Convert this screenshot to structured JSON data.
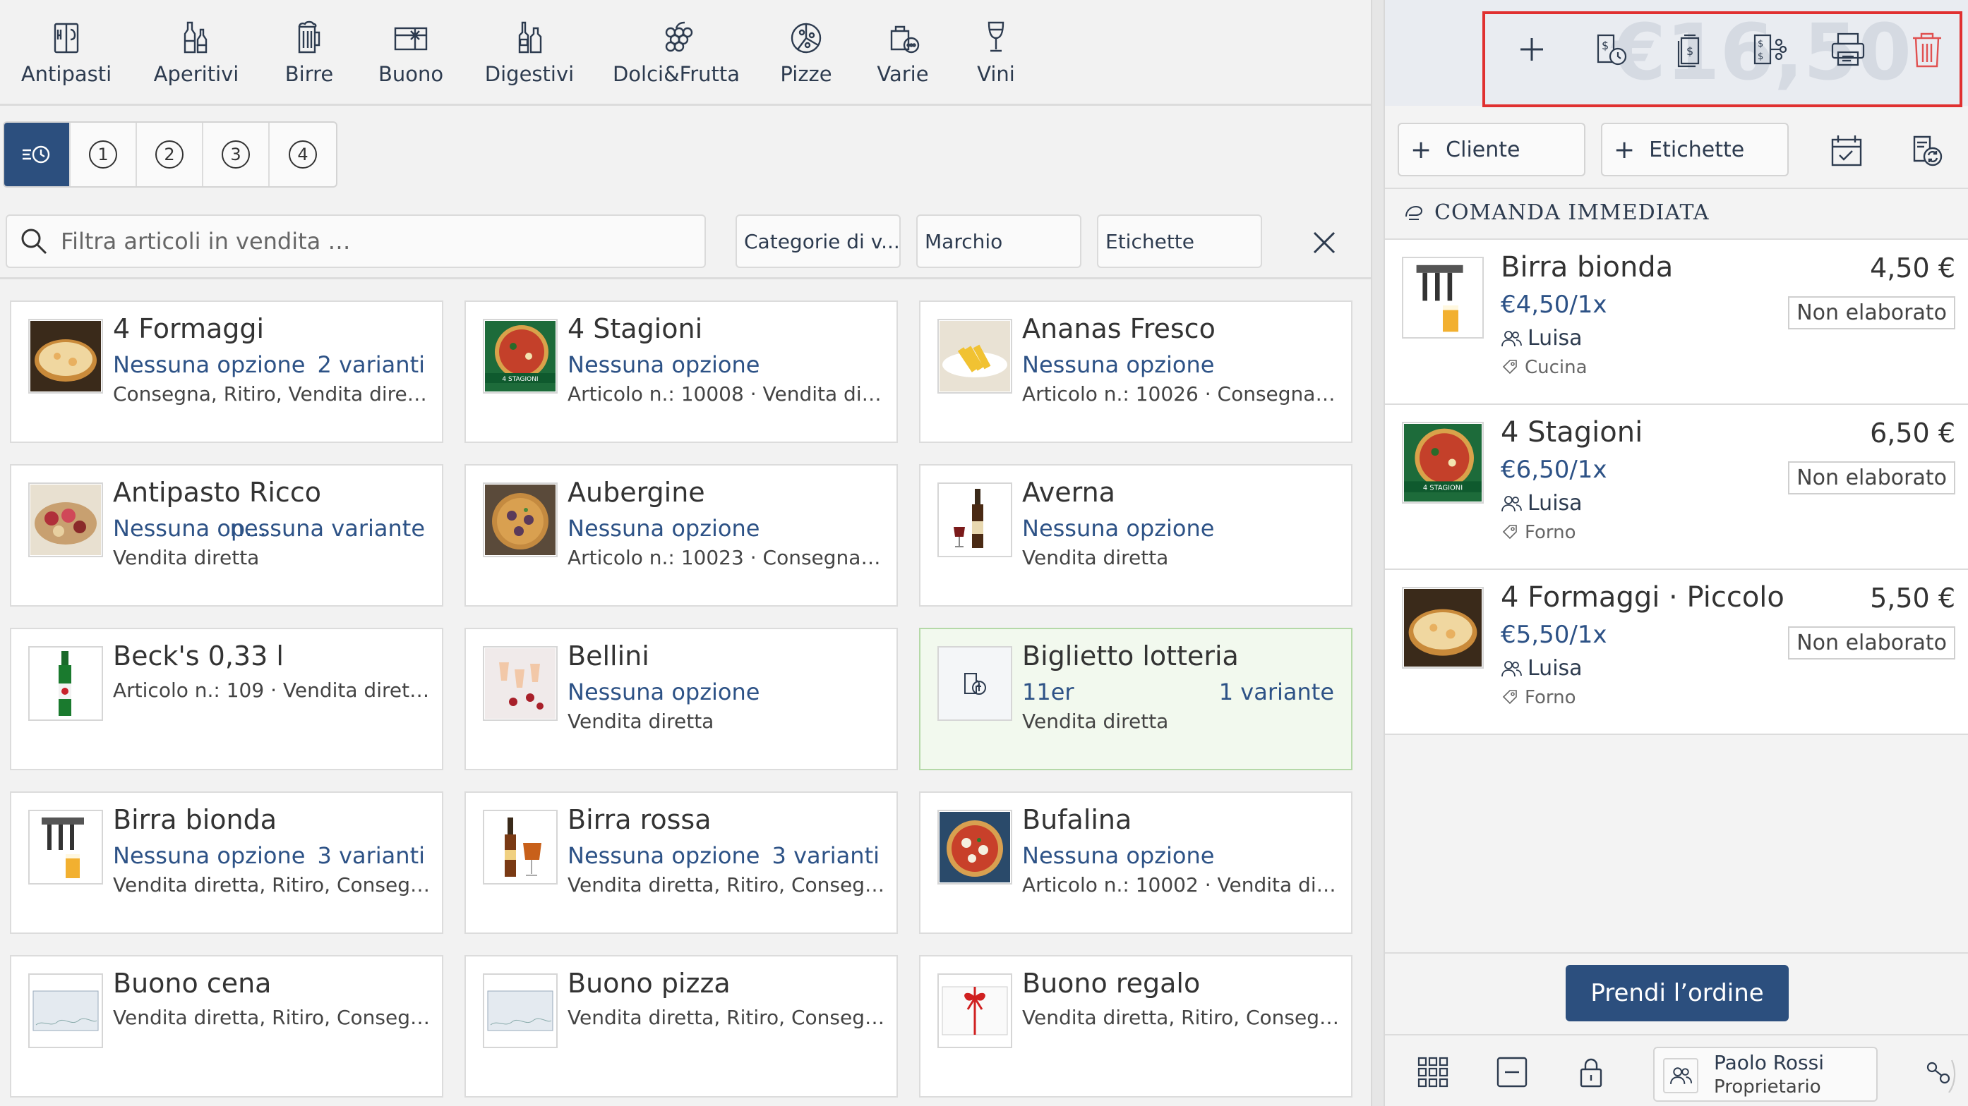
{
  "categories": [
    {
      "label": "Antipasti",
      "icon": "menu-card-icon"
    },
    {
      "label": "Aperitivi",
      "icon": "bottles-icon"
    },
    {
      "label": "Birre",
      "icon": "beer-mug-icon"
    },
    {
      "label": "Buono",
      "icon": "voucher-icon"
    },
    {
      "label": "Digestivi",
      "icon": "digestive-bottles-icon"
    },
    {
      "label": "Dolci&Frutta",
      "icon": "grapes-icon"
    },
    {
      "label": "Pizze",
      "icon": "pizza-icon"
    },
    {
      "label": "Varie",
      "icon": "misc-bag-icon"
    },
    {
      "label": "Vini",
      "icon": "wine-glass-icon"
    }
  ],
  "courses": [
    "1",
    "2",
    "3",
    "4"
  ],
  "search": {
    "placeholder": "Filtra articoli in vendita …",
    "filters": [
      "Categorie di v...",
      "Marchio",
      "Etichette"
    ]
  },
  "products": [
    {
      "name": "4 Formaggi",
      "option": "Nessuna opzione",
      "variants": "2 varianti",
      "meta": "Consegna, Ritiro, Vendita diretta"
    },
    {
      "name": "4 Stagioni",
      "option": "Nessuna opzione",
      "variants": "",
      "meta": "Articolo n.: 10008 · Vendita dirett..."
    },
    {
      "name": "Ananas Fresco",
      "option": "Nessuna opzione",
      "variants": "",
      "meta": "Articolo n.: 10026 · Consegna, Rit..."
    },
    {
      "name": "Antipasto Ricco",
      "option": "Nessuna op...",
      "variants": "nessuna variante",
      "meta": "Vendita diretta"
    },
    {
      "name": "Aubergine",
      "option": "Nessuna opzione",
      "variants": "",
      "meta": "Articolo n.: 10023 · Consegna, Rit..."
    },
    {
      "name": "Averna",
      "option": "Nessuna opzione",
      "variants": "",
      "meta": "Vendita diretta"
    },
    {
      "name": "Beck's 0,33 l",
      "option": "",
      "variants": "",
      "meta": "Articolo n.: 109 · Vendita diretta, ..."
    },
    {
      "name": "Bellini",
      "option": "Nessuna opzione",
      "variants": "",
      "meta": "Vendita diretta"
    },
    {
      "name": "Biglietto lotteria",
      "option": "11er",
      "variants": "1 variante",
      "meta": "Vendita diretta"
    },
    {
      "name": "Birra bionda",
      "option": "Nessuna opzione",
      "variants": "3 varianti",
      "meta": "Vendita diretta, Ritiro, Consegna"
    },
    {
      "name": "Birra rossa",
      "option": "Nessuna opzione",
      "variants": "3 varianti",
      "meta": "Vendita diretta, Ritiro, Consegna"
    },
    {
      "name": "Bufalina",
      "option": "Nessuna opzione",
      "variants": "",
      "meta": "Articolo n.: 10002 · Vendita dirett..."
    },
    {
      "name": "Buono cena",
      "option": "",
      "variants": "",
      "meta": "Vendita diretta, Ritiro, Consegna"
    },
    {
      "name": "Buono pizza",
      "option": "",
      "variants": "",
      "meta": "Vendita diretta, Ritiro, Consegna"
    },
    {
      "name": "Buono regalo",
      "option": "",
      "variants": "",
      "meta": "Vendita diretta, Ritiro, Consegna"
    }
  ],
  "order_panel": {
    "total_watermark": "€16,50",
    "customer_label": "Cliente",
    "tags_label": "Etichette",
    "section_title": "COMANDA IMMEDIATA",
    "items": [
      {
        "name": "Birra bionda",
        "unit_price": "€4,50/1x",
        "user": "Luisa",
        "station": "Cucina",
        "total": "4,50 €",
        "status": "Non elaborato"
      },
      {
        "name": "4 Stagioni",
        "unit_price": "€6,50/1x",
        "user": "Luisa",
        "station": "Forno",
        "total": "6,50 €",
        "status": "Non elaborato"
      },
      {
        "name": "4 Formaggi · Piccolo",
        "unit_price": "€5,50/1x",
        "user": "Luisa",
        "station": "Forno",
        "total": "5,50 €",
        "status": "Non elaborato"
      }
    ],
    "take_order_label": "Prendi l’ordine",
    "user_name": "Paolo Rossi",
    "user_role": "Proprietario"
  },
  "colors": {
    "accent": "#2c4f7e",
    "link_blue": "#2d5286",
    "highlight_green": "#f2f9ee",
    "annotation_red": "#e03030",
    "trash_red": "#e05050"
  }
}
